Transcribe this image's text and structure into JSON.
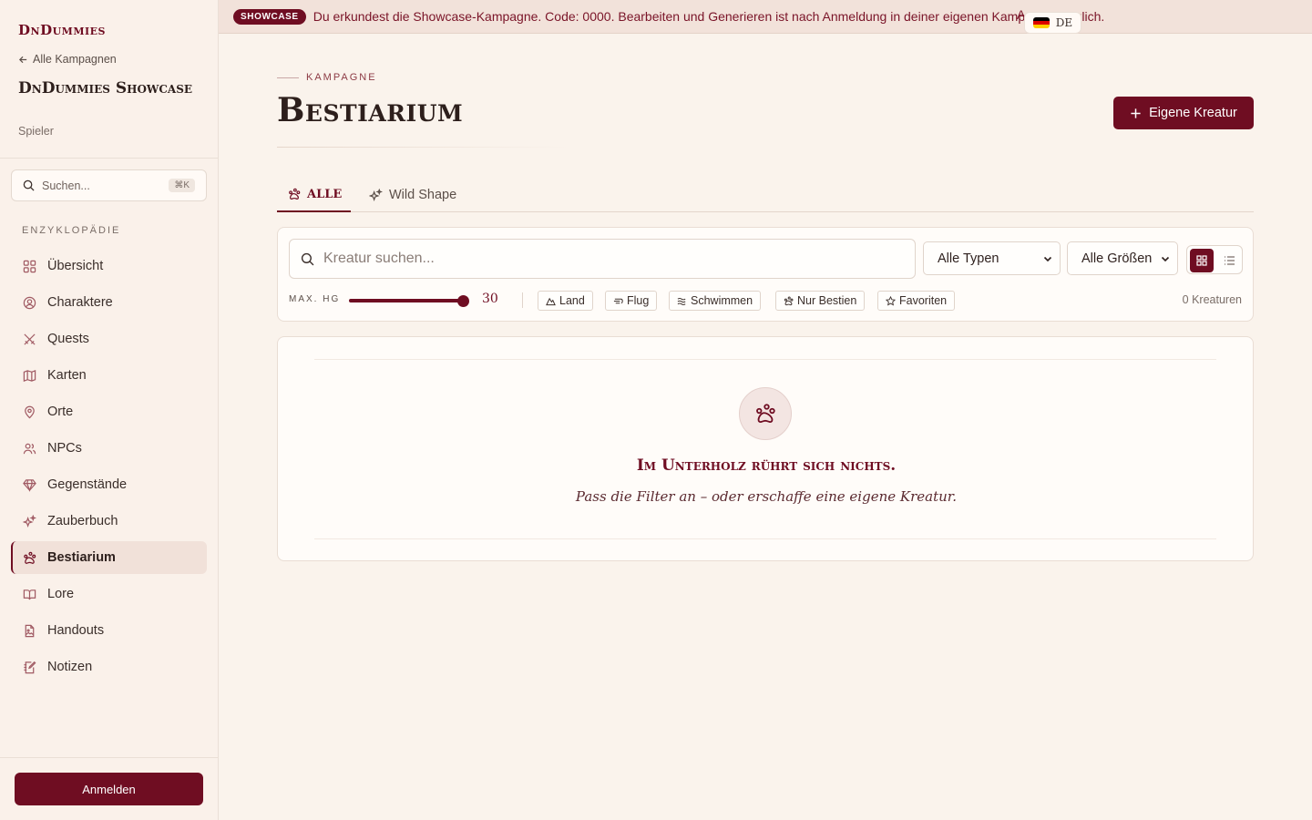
{
  "sidebar": {
    "brand": "DnDummies",
    "back_label": "Alle Kampagnen",
    "campaign_name": "DnDummies Showcase",
    "role": "Spieler",
    "search_placeholder": "Suchen...",
    "search_shortcut": "⌘K",
    "section_label": "ENZYKLOPÄDIE",
    "items": [
      {
        "label": "Übersicht",
        "icon": "grid-icon"
      },
      {
        "label": "Charaktere",
        "icon": "user-circle-icon"
      },
      {
        "label": "Quests",
        "icon": "crossed-swords-icon"
      },
      {
        "label": "Karten",
        "icon": "map-icon"
      },
      {
        "label": "Orte",
        "icon": "map-pin-icon"
      },
      {
        "label": "NPCs",
        "icon": "users-icon"
      },
      {
        "label": "Gegenstände",
        "icon": "gem-icon"
      },
      {
        "label": "Zauberbuch",
        "icon": "sparkles-icon"
      },
      {
        "label": "Bestiarium",
        "icon": "paw-icon"
      },
      {
        "label": "Lore",
        "icon": "book-open-icon"
      },
      {
        "label": "Handouts",
        "icon": "file-image-icon"
      },
      {
        "label": "Notizen",
        "icon": "notebook-pen-icon"
      }
    ],
    "active_item": "Bestiarium",
    "login_label": "Anmelden"
  },
  "banner": {
    "badge": "SHOWCASE",
    "text": "Du erkundest die Showcase-Kampagne. Code: 0000. Bearbeiten und Generieren ist nach Anmeldung in deiner eigenen Kampagne möglich.",
    "cut_text": "A",
    "lang": "DE"
  },
  "header": {
    "eyebrow": "KAMPAGNE",
    "title": "Bestiarium",
    "own_button": "Eigene Kreatur"
  },
  "tabs": [
    {
      "label": "ALLE",
      "active": true
    },
    {
      "label": "Wild Shape",
      "active": false
    }
  ],
  "filters": {
    "search_placeholder": "Kreatur suchen...",
    "type_select": "Alle Typen",
    "size_select": "Alle Größen",
    "max_hg_label": "MAX. HG",
    "max_hg_value": "30",
    "chips": [
      "Land",
      "Flug",
      "Schwimmen",
      "Nur Bestien",
      "Favoriten"
    ],
    "count": "0 Kreaturen"
  },
  "empty": {
    "title": "Im Unterholz rührt sich nichts.",
    "subtitle": "Pass die Filter an – oder erschaffe eine eigene Kreatur."
  },
  "colors": {
    "accent": "#6f0d22",
    "background": "#faf3ec"
  }
}
